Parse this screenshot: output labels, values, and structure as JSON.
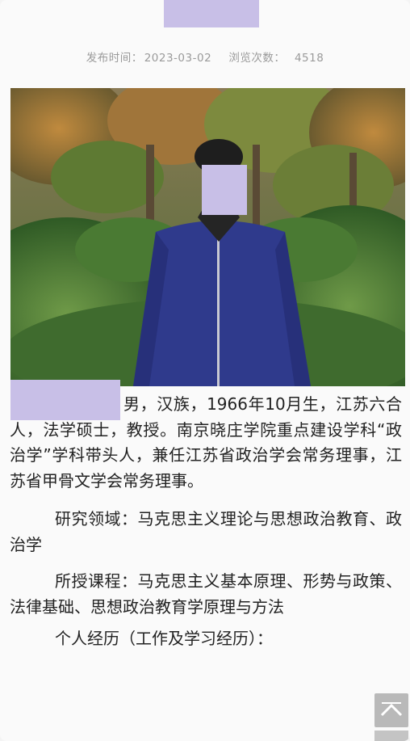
{
  "article": {
    "publish_label": "发布时间：",
    "publish_date": "2023-03-02",
    "views_label": "浏览次数：",
    "views_count": "4518"
  },
  "bio": {
    "intro_first": "男，汉族，1966年10月生，江苏",
    "intro_rest": "六合人，法学硕士，教授。南京晓庄学院重点建设学科“政治学”学科带头人，兼任江苏省政治学会常务理事，江苏省甲骨文学会常务理事。",
    "research_label": "研究领域：",
    "research_value": "马克思主义理论与思想政治教育、政治学",
    "courses_label": "所授课程：",
    "courses_value": "马克思主义基本原理、形势与政策、法律基础、思想政治教育学原理与方法",
    "experience_heading": "个人经历（工作及学习经历）："
  },
  "icons": {
    "back_to_top": "chevron-up-icon"
  },
  "colors": {
    "redaction": "#c8bfe7",
    "jacket": "#2f3a8c",
    "foliage": "#3f6b2e"
  }
}
